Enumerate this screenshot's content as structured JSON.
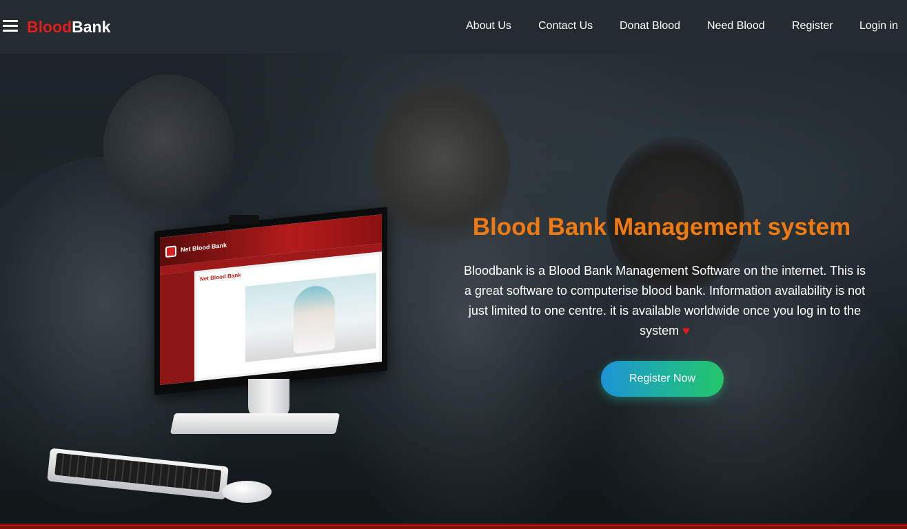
{
  "brand": {
    "part1": "Blood",
    "part2": "Bank"
  },
  "nav": {
    "links": [
      {
        "label": "About Us"
      },
      {
        "label": "Contact Us"
      },
      {
        "label": "Donat Blood"
      },
      {
        "label": "Need Blood"
      },
      {
        "label": "Register"
      },
      {
        "label": "Login in"
      }
    ]
  },
  "hero": {
    "title": "Blood Bank Management system",
    "description": "Bloodbank is a Blood Bank Management Software on the internet. This is a great software to computerise blood bank. Information availability is not just limited to one centre. it is available worldwide once you log in to the system",
    "heart_icon": "♥",
    "register_button": "Register Now"
  },
  "illustration": {
    "screen_title": "Net Blood Bank",
    "banner_title": "Net Blood Bank"
  },
  "colors": {
    "brand_red": "#e11d1d",
    "title_orange": "#f07a12",
    "button_gradient_start": "#1d93d6",
    "button_gradient_end": "#24c56a",
    "navbar_bg": "#242c31"
  }
}
